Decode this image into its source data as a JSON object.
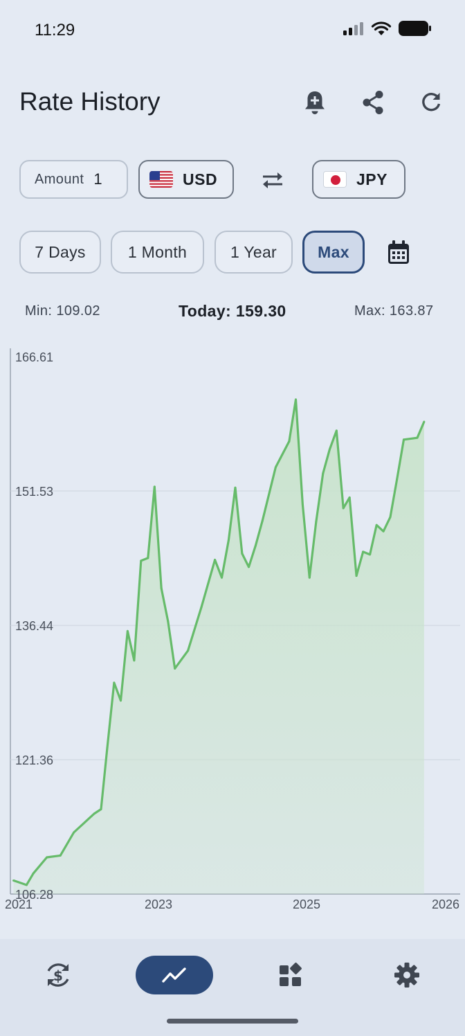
{
  "status": {
    "time": "11:29"
  },
  "header": {
    "title": "Rate History"
  },
  "converter": {
    "amount_label": "Amount",
    "amount_value": "1",
    "from_code": "USD",
    "to_code": "JPY"
  },
  "ranges": [
    {
      "label": "7 Days"
    },
    {
      "label": "1 Month"
    },
    {
      "label": "1 Year"
    },
    {
      "label": "Max",
      "active": true
    }
  ],
  "stats": {
    "min": "Min: 109.02",
    "today": "Today: 159.30",
    "max": "Max: 163.87"
  },
  "colors": {
    "accent": "#2c4a7a",
    "line": "#66bb6a",
    "fill": "#c8e3cb",
    "background": "#e4eaf3"
  },
  "icons": [
    "bell-plus-icon",
    "share-icon",
    "refresh-icon",
    "swap-icon",
    "calendar-icon",
    "currency-exchange-icon",
    "chart-icon",
    "widgets-icon",
    "gear-icon"
  ],
  "chart_data": {
    "type": "area",
    "title": "",
    "xlabel": "",
    "ylabel": "",
    "y_ticks": [
      "166.61",
      "151.53",
      "136.44",
      "121.36",
      "106.28"
    ],
    "ylim": [
      106.28,
      166.61
    ],
    "x_ticks": [
      "2021",
      "2023",
      "2025",
      "2026"
    ],
    "xlim": [
      "2021-01-01",
      "2026-06-30"
    ],
    "grid": true,
    "series": [
      {
        "x": [
          "2021-01",
          "2021-03",
          "2021-04",
          "2021-06",
          "2021-08",
          "2021-10",
          "2022-01",
          "2022-02",
          "2022-03",
          "2022-04",
          "2022-05",
          "2022-06",
          "2022-07",
          "2022-08",
          "2022-09",
          "2022-10",
          "2022-11",
          "2022-12",
          "2023-01",
          "2023-03",
          "2023-05",
          "2023-07",
          "2023-08",
          "2023-09",
          "2023-10",
          "2023-11",
          "2023-12",
          "2024-01",
          "2024-02",
          "2024-04",
          "2024-06",
          "2024-07",
          "2024-08",
          "2024-09",
          "2024-10",
          "2024-11",
          "2024-12",
          "2025-01",
          "2025-02",
          "2025-03",
          "2025-04",
          "2025-05",
          "2025-06",
          "2025-07",
          "2025-08",
          "2025-09",
          "2025-10",
          "2025-11",
          "2026-01",
          "2026-02"
        ],
        "values": [
          107.8,
          107.3,
          108.6,
          110.4,
          110.6,
          113.2,
          115.3,
          115.8,
          122.7,
          130.0,
          128.0,
          135.8,
          132.5,
          143.7,
          144.0,
          152.0,
          140.6,
          136.9,
          131.6,
          133.6,
          138.5,
          143.8,
          141.8,
          146.0,
          151.9,
          144.5,
          143.0,
          145.4,
          148.2,
          154.2,
          157.1,
          161.8,
          150.0,
          141.8,
          148.1,
          153.5,
          156.2,
          158.3,
          149.6,
          150.8,
          142.0,
          144.7,
          144.4,
          147.7,
          147.0,
          148.6,
          152.8,
          157.3,
          157.5,
          159.3
        ]
      }
    ]
  }
}
